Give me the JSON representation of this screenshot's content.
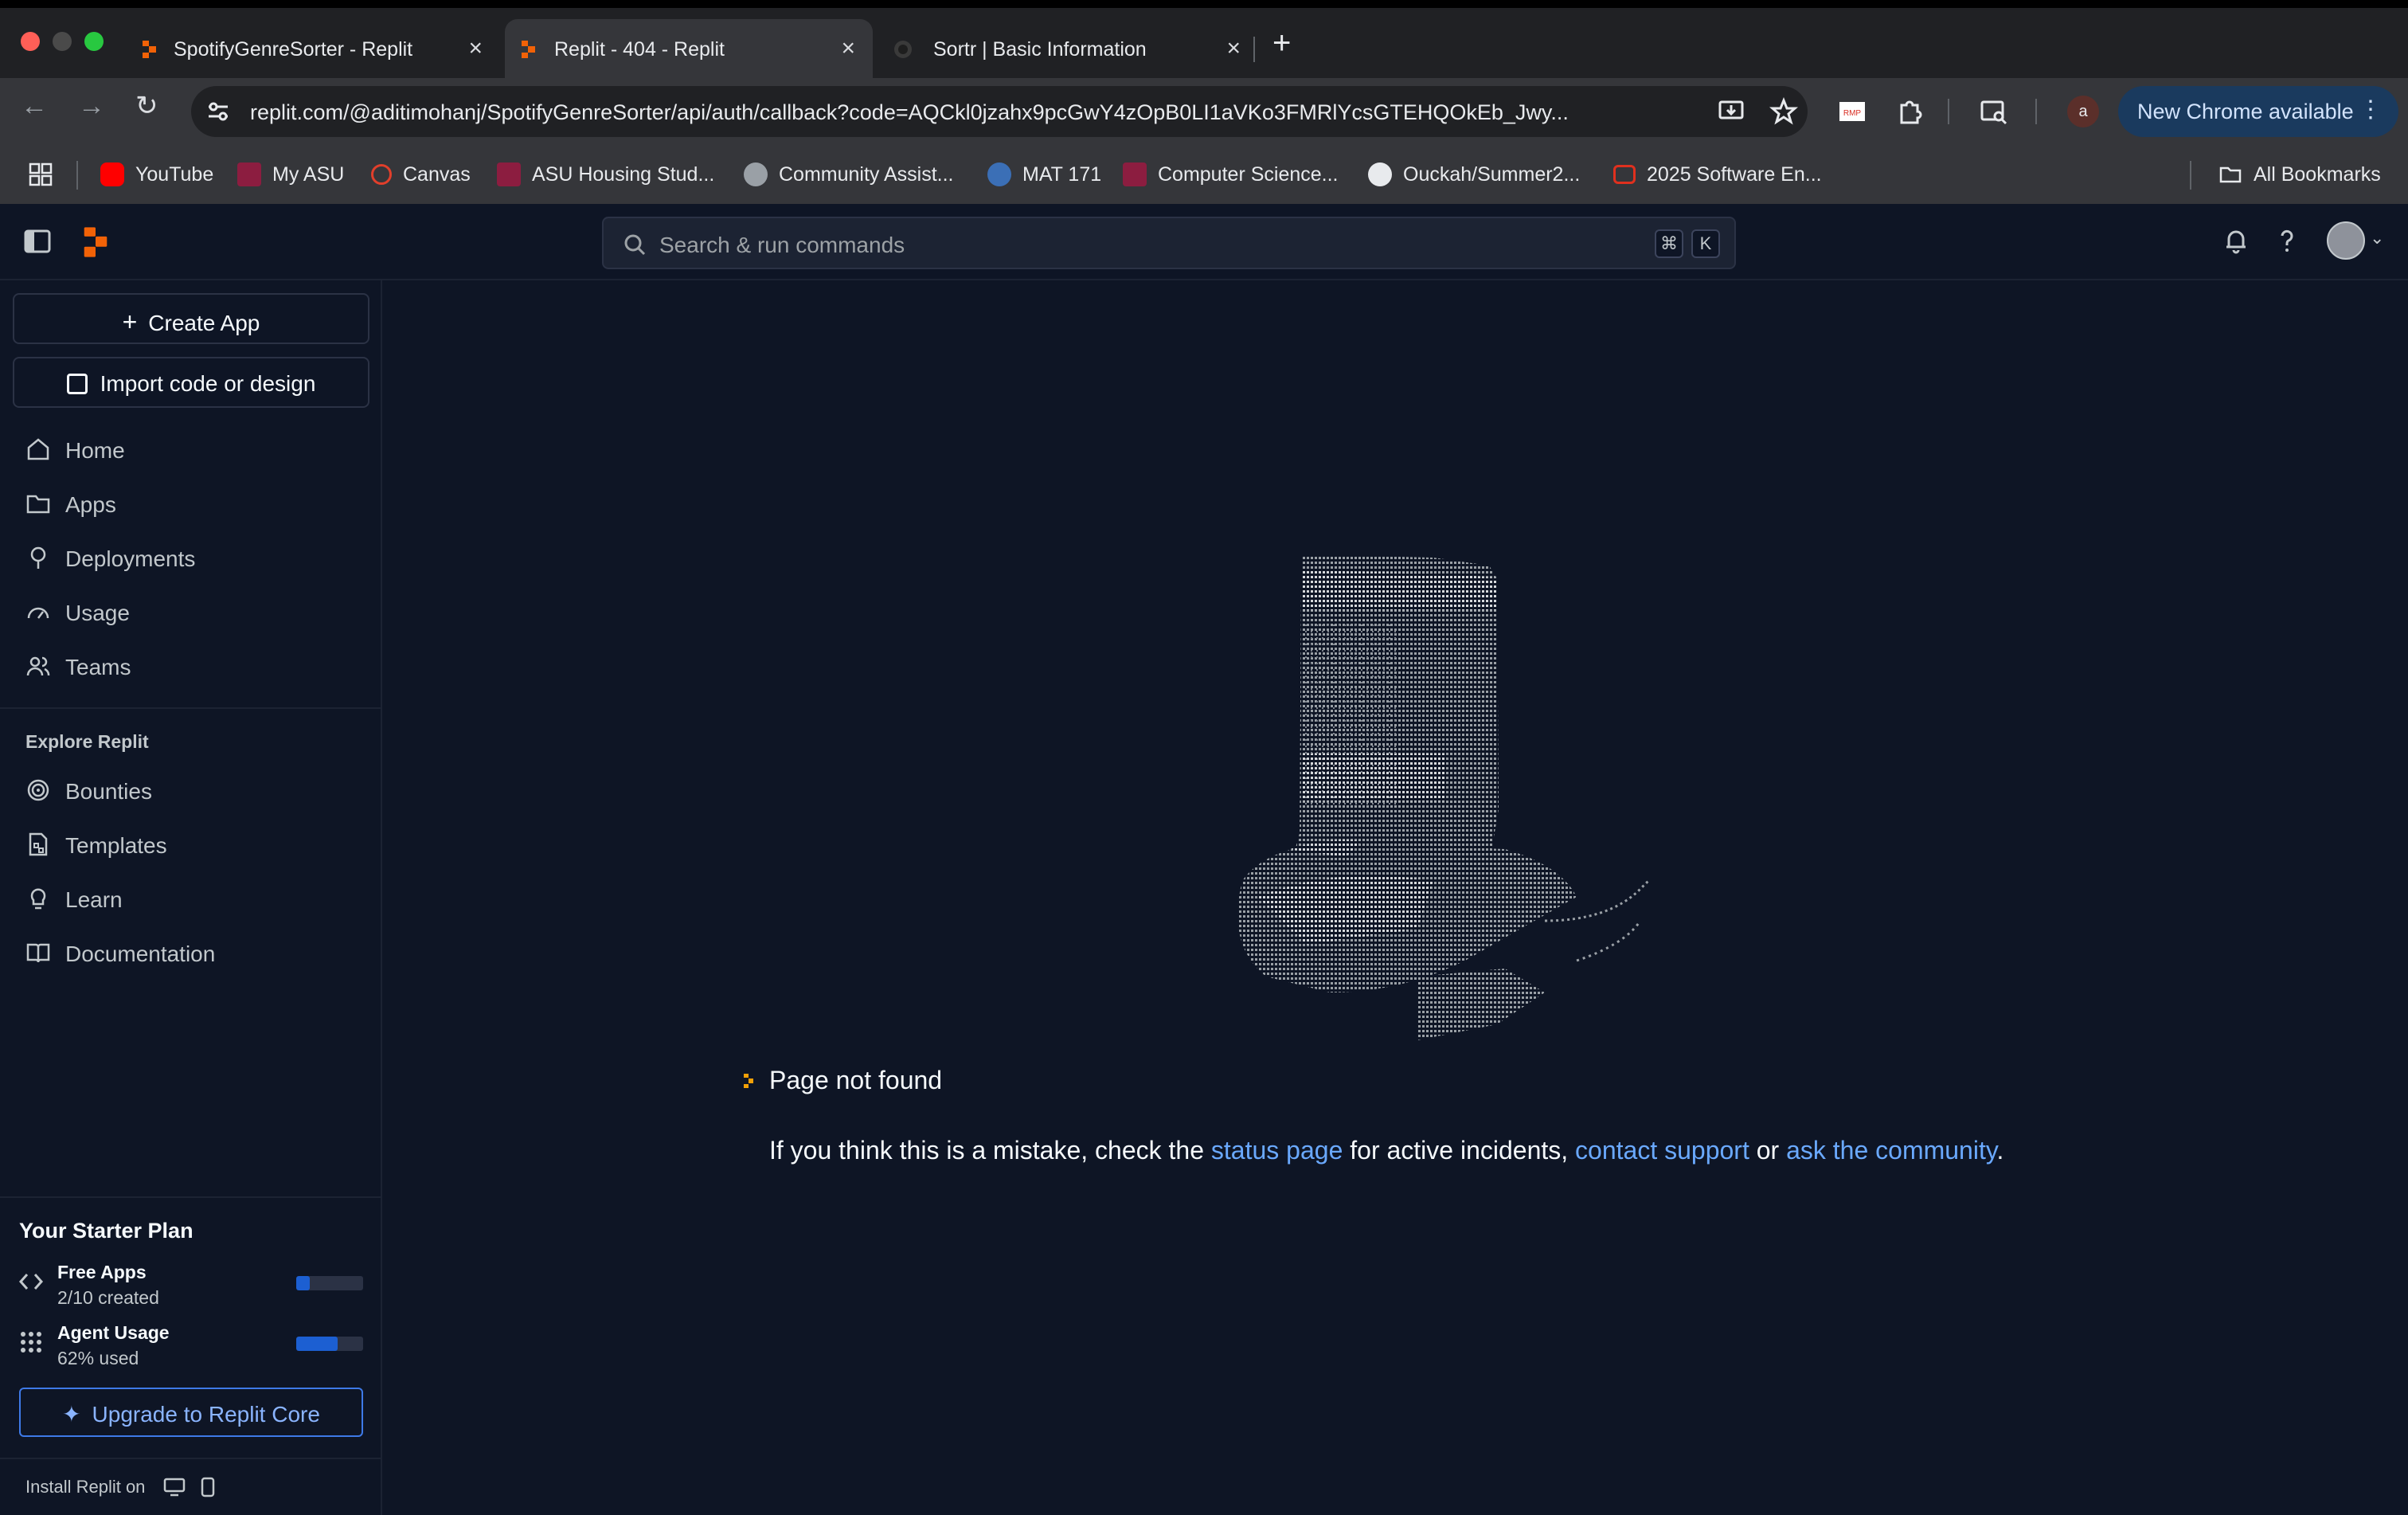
{
  "browser": {
    "tabs": [
      {
        "title": "SpotifyGenreSorter - Replit",
        "active": false
      },
      {
        "title": "Replit - 404 - Replit",
        "active": true
      },
      {
        "title": "Sortr | Basic Information",
        "active": false
      }
    ],
    "url": "replit.com/@aditimohanj/SpotifyGenreSorter/api/auth/callback?code=AQCkl0jzahx9pcGwY4zOpB0LI1aVKo3FMRlYcsGTEHQOkEb_Jwy...",
    "profile_initial": "a",
    "update_label": "New Chrome available"
  },
  "bookmarks": [
    {
      "label": "YouTube",
      "icon": "youtube-icon"
    },
    {
      "label": "My ASU",
      "icon": "asu-icon"
    },
    {
      "label": "Canvas",
      "icon": "canvas-icon"
    },
    {
      "label": "ASU Housing Stud...",
      "icon": "asu-icon"
    },
    {
      "label": "Community Assist...",
      "icon": "globe-icon"
    },
    {
      "label": "MAT 171",
      "icon": "pearson-icon"
    },
    {
      "label": "Computer Science...",
      "icon": "asu-icon"
    },
    {
      "label": "Ouckah/Summer2...",
      "icon": "github-icon"
    },
    {
      "label": "2025 Software En...",
      "icon": "oracle-icon"
    }
  ],
  "all_bookmarks_label": "All Bookmarks",
  "header": {
    "search_placeholder": "Search & run commands",
    "kbd_cmd": "⌘",
    "kbd_k": "K"
  },
  "sidebar": {
    "create_app": "Create App",
    "import_code": "Import code or design",
    "nav": [
      {
        "label": "Home",
        "icon": "home-icon"
      },
      {
        "label": "Apps",
        "icon": "folder-icon"
      },
      {
        "label": "Deployments",
        "icon": "deploy-icon"
      },
      {
        "label": "Usage",
        "icon": "gauge-icon"
      },
      {
        "label": "Teams",
        "icon": "people-icon"
      }
    ],
    "explore_heading": "Explore Replit",
    "explore": [
      {
        "label": "Bounties",
        "icon": "bounty-icon"
      },
      {
        "label": "Templates",
        "icon": "template-icon"
      },
      {
        "label": "Learn",
        "icon": "bulb-icon"
      },
      {
        "label": "Documentation",
        "icon": "book-icon"
      }
    ],
    "plan": {
      "title": "Your Starter Plan",
      "free_apps_label": "Free Apps",
      "free_apps_sub": "2/10 created",
      "free_apps_fraction": 0.2,
      "agent_label": "Agent Usage",
      "agent_sub": "62% used",
      "agent_fraction": 0.62
    },
    "upgrade": "Upgrade to Replit Core",
    "install": "Install Replit on"
  },
  "main": {
    "title": "Page not found",
    "msg_prefix": "If you think this is a mistake, check the",
    "status_link": "status page",
    "msg_mid": "for active incidents,",
    "support_link": "contact support",
    "msg_or": "or",
    "community_link": "ask the community",
    "msg_end": "."
  },
  "colors": {
    "background": "#0e1525",
    "link": "#6aa9ff",
    "accent": "#1c5fd2",
    "replit_orange": "#f26207"
  }
}
